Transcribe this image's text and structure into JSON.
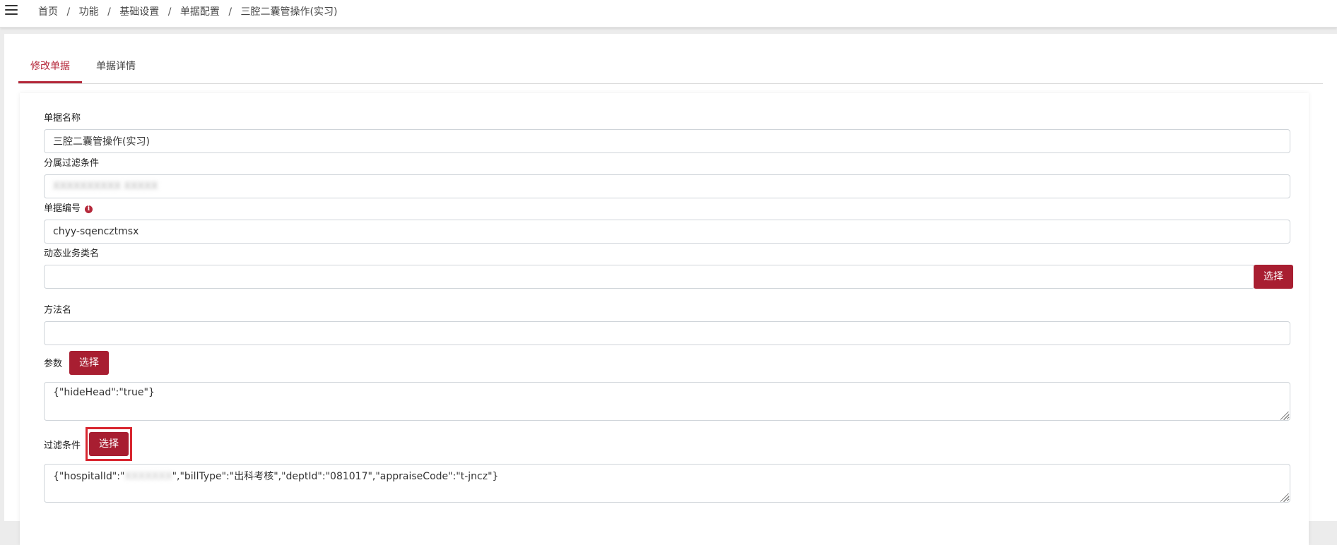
{
  "breadcrumb": {
    "items": [
      "首页",
      "功能",
      "基础设置",
      "单据配置",
      "三腔二囊管操作(实习)"
    ],
    "separator": "/"
  },
  "tabs": [
    {
      "label": "修改单据",
      "active": true
    },
    {
      "label": "单据详情",
      "active": false
    }
  ],
  "form": {
    "bill_name": {
      "label": "单据名称",
      "value": "三腔二囊管操作(实习)"
    },
    "filter_dept": {
      "label": "分属过滤条件",
      "value": "XXXXXXXXXX XXXXX"
    },
    "bill_code": {
      "label": "单据编号",
      "value": "chyy-sqencztmsx"
    },
    "dynamic_class": {
      "label": "动态业务类名",
      "value": "",
      "button": "选择"
    },
    "method_name": {
      "label": "方法名",
      "value": ""
    },
    "params": {
      "label": "参数",
      "button": "选择",
      "value": "{\"hideHead\":\"true\"}"
    },
    "filter_cond": {
      "label": "过滤条件",
      "button": "选择",
      "value_prefix": "{\"hospitalId\":\"",
      "value_hidden": "XXXXXXX",
      "value_suffix": "\",\"billType\":\"出科考核\",\"deptId\":\"081017\",\"appraiseCode\":\"t-jncz\"}"
    }
  },
  "colors": {
    "accent": "#a81e31",
    "highlight": "#d8262f"
  }
}
